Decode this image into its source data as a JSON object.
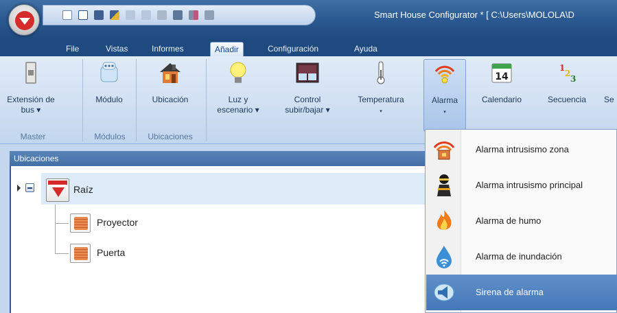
{
  "window": {
    "title": "Smart House Configurator * [ C:\\Users\\MOLOLA\\D"
  },
  "menu_tabs": [
    "File",
    "Vistas",
    "Informes",
    "Añadir",
    "Configuración",
    "Ayuda"
  ],
  "active_tab": "Añadir",
  "ribbon": {
    "buttons": [
      {
        "line1": "Extensión de",
        "line2": "bus ▾",
        "icon": "bus-extension-icon"
      },
      {
        "line1": "Módulo",
        "line2": "",
        "icon": "module-icon"
      },
      {
        "line1": "Ubicación",
        "line2": "",
        "icon": "house-icon"
      },
      {
        "line1": "Luz y",
        "line2": "escenario ▾",
        "icon": "light-bulb-icon"
      },
      {
        "line1": "Control",
        "line2": "subir/bajar ▾",
        "icon": "blind-icon"
      },
      {
        "line1": "Temperatura",
        "line2": "▾",
        "icon": "thermometer-icon"
      },
      {
        "line1": "Alarma",
        "line2": "▾",
        "icon": "alarm-icon"
      },
      {
        "line1": "Calendario",
        "line2": "",
        "icon": "calendar-icon",
        "badge": "14"
      },
      {
        "line1": "Secuencia",
        "line2": "",
        "icon": "sequence-icon"
      },
      {
        "line1": "Se",
        "line2": "",
        "icon": "cropped-icon"
      }
    ],
    "groups": [
      "Master",
      "Módulos",
      "Ubicaciones"
    ]
  },
  "panel": {
    "title": "Ubicaciones",
    "tree": {
      "root": "Raíz",
      "children": [
        "Proyector",
        "Puerta"
      ]
    }
  },
  "dropdown": {
    "items": [
      {
        "label": "Alarma intrusismo zona",
        "icon": "intrusion-zone-icon"
      },
      {
        "label": "Alarma intrusismo principal",
        "icon": "intruder-icon"
      },
      {
        "label": "Alarma de humo",
        "icon": "smoke-fire-icon"
      },
      {
        "label": "Alarma de inundación",
        "icon": "flood-drop-icon"
      },
      {
        "label": "Sirena de alarma",
        "icon": "siren-icon"
      }
    ],
    "highlighted": "Sirena de alarma"
  },
  "colors": {
    "title_bar": "#2c5a92",
    "ribbon": "#cfdff2",
    "menu_highlight": "#5284c1",
    "brand_red": "#d52b2b"
  }
}
